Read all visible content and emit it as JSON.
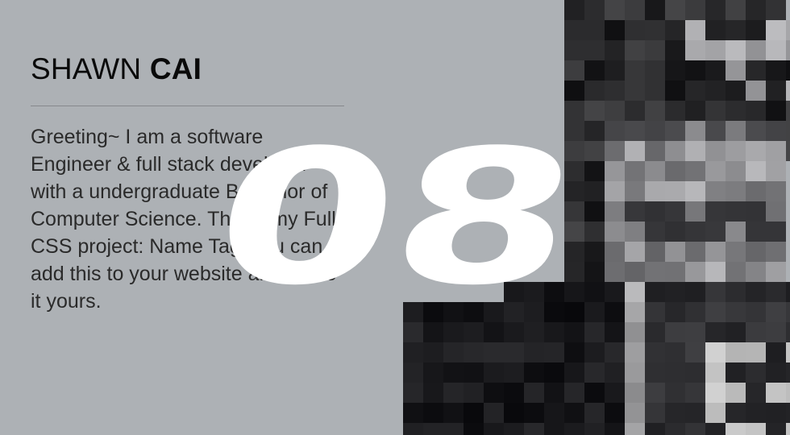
{
  "card": {
    "first_name": "SHAWN",
    "last_name": "CAI",
    "bio": "Greeting~ I am a software Engineer & full stack developer with a undergraduate Bachelor of Computer Science. This is my Fully CSS project: Name Tag, you can add this to your website and make it yours.",
    "number": "08"
  },
  "portrait": {
    "icon": "pixelated-portrait-image"
  },
  "colors": {
    "background": "#adb1b5",
    "name_text": "#0a0a0a",
    "bio_text": "#2a2a2a",
    "divider": "#86898c",
    "number": "#ffffff"
  }
}
